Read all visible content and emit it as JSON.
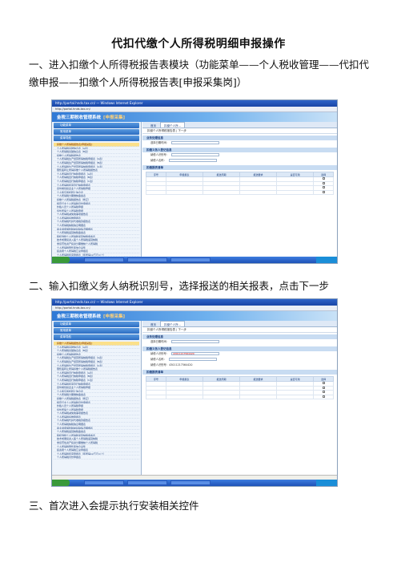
{
  "document": {
    "title": "代扣代缴个人所得税明细申报操作",
    "step1": "一、进入扣缴个人所得税报告表模块（功能菜单——个人税收管理——代扣代缴申报——扣缴个人所得税报告表[申报采集岗]）",
    "step2": "二、输入扣缴义务人纳税识别号，选择报送的相关报表，点击下一步",
    "step3": "三、首次进入会提示执行安装相关控件"
  },
  "screenshot": {
    "browser_title": "http://portal.hnds.tax.cn/ — Windows Internet Explorer",
    "address": "http://portal.hnds.tax.cn/",
    "banner_text": "金税三期税收管理系统",
    "banner_badge": "[申报采集]",
    "nav_buttons": [
      "功能菜单",
      "常用菜单",
      "菜单导航"
    ],
    "tabs": [
      "首页",
      "扣缴个人所..."
    ],
    "toolbar": "扣缴个人所得税报告表 | 下一步",
    "section_basic": "业务处理信息",
    "date_label": "选择日期时间：",
    "section_payer": "扣缴义务人登记信息",
    "taxpayer_id_label": "纳税人识别号：",
    "taxpayer_name_label": "纳税人名称：",
    "taxpayer_id_value": "43011217564420",
    "section_reports": "扣缴报表清单",
    "table_headers": [
      "序号",
      "申报报表",
      "报送周期",
      "报送要求",
      "是否可用",
      "选择"
    ],
    "menu_items": [
      "扣缴个人所得税报告表[申报采集]",
      "个人所得税基础信息表（A表）",
      "个人所得税基础信息表（B表）",
      "扣缴个人所得税报告表",
      "个人所得税生产经营所得纳税申报表（A表）",
      "个人所得税生产经营所得纳税申报表（B表）",
      "个人所得税生产经营所得纳税申报表（C表）",
      "限售股转让所得扣缴个人所得税报告表",
      "个人所得税自行纳税申报表（A表）",
      "个人所得税自行纳税申报表（B表）",
      "个人所得税自行纳税申报表（C表）",
      "个人所得税年度自行纳税申报表",
      "合伙制创投企业个人所得税申报",
      "个人股东股权转让信息表",
      "个人所得税分期缴纳备案表",
      "扣缴个人所得税报告表（修正）",
      "特定行业个人所得税月份申报表",
      "外籍人员个人所得税申报",
      "境外所得个人所得税申报",
      "个人所得税减免税事项报告表",
      "个人所得税扣缴申报表",
      "个人所得税代扣代收税款报告表",
      "个人所得税纳税信息明细表",
      "商业健康保险税前扣除情况明细表",
      "个人所得税递延纳税备案表",
      "股权激励个人所得税递延纳税备案表",
      "技术成果投资入股个人所得税递延纳税",
      "非货币性资产投资分期缴纳个人所得税",
      "个人所得税限售股信息采集",
      "投资者个人所得税汇总申报表",
      "个人所得税年度申报表（年所得12万元以上）",
      "个人所得税月份申报表"
    ]
  }
}
